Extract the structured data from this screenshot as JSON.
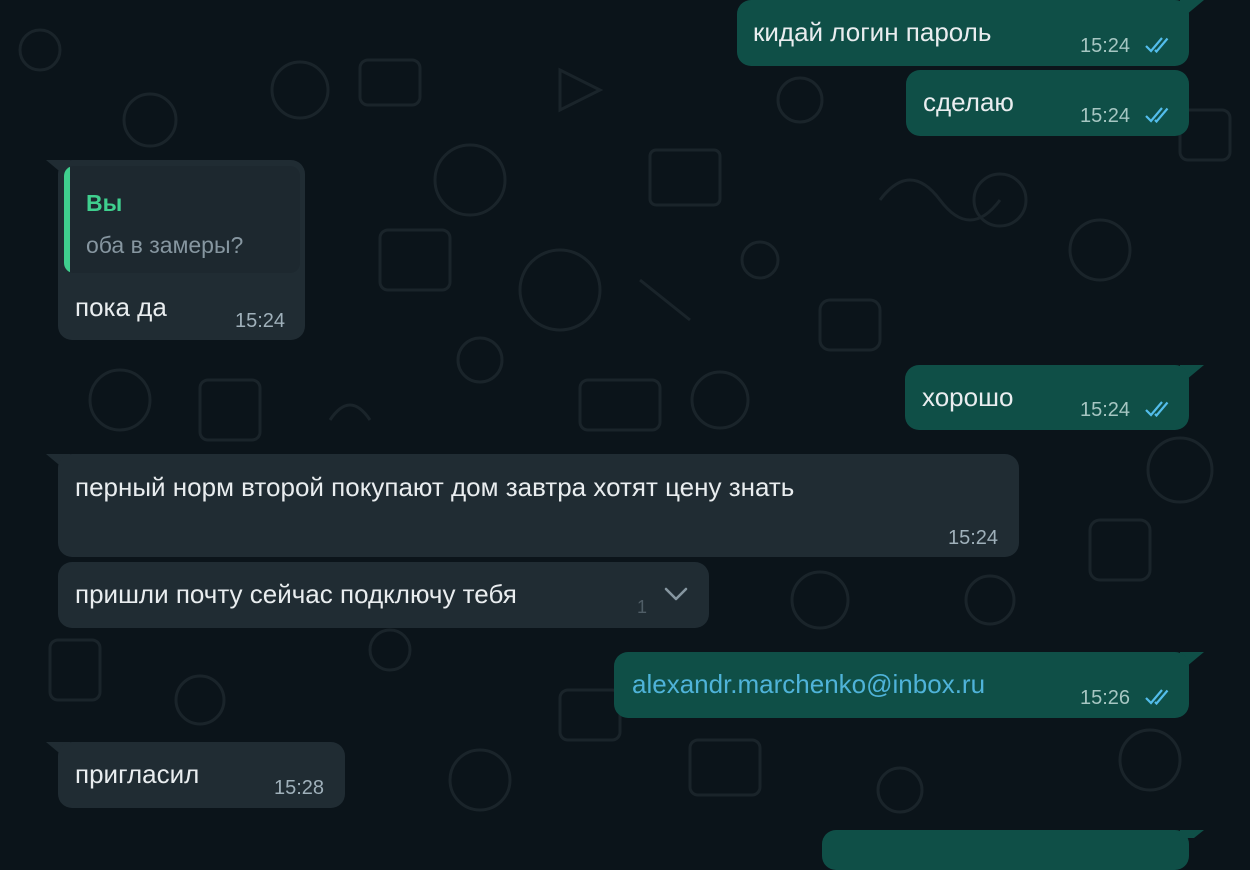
{
  "colors": {
    "background": "#0b141a",
    "outgoing_bubble": "#0f4f47",
    "incoming_bubble": "#202c33",
    "read_ticks": "#53bdeb",
    "quote_accent": "#3fcf8e",
    "link": "#4fb3d9"
  },
  "messages": [
    {
      "direction": "outgoing",
      "text": "кидай логин пароль",
      "time": "15:24",
      "status": "read-double-check-icon"
    },
    {
      "direction": "outgoing",
      "text": "сделаю",
      "time": "15:24",
      "status": "read-double-check-icon"
    },
    {
      "direction": "incoming",
      "quote": {
        "author": "Вы",
        "text": "оба в замеры?"
      },
      "text": "пока да",
      "time": "15:24"
    },
    {
      "direction": "outgoing",
      "text": "хорошо",
      "time": "15:24",
      "status": "read-double-check-icon"
    },
    {
      "direction": "incoming",
      "text": "перный норм второй покупают дом завтра хотят цену знать",
      "time": "15:24"
    },
    {
      "direction": "incoming",
      "text": "пришли почту сейчас подключу тебя",
      "time": "1",
      "icon": "chevron-down-icon"
    },
    {
      "direction": "outgoing",
      "text": "alexandr.marchenko@inbox.ru",
      "time": "15:26",
      "status": "read-double-check-icon",
      "is_link": true
    },
    {
      "direction": "incoming",
      "text": "пригласил",
      "time": "15:28"
    }
  ]
}
